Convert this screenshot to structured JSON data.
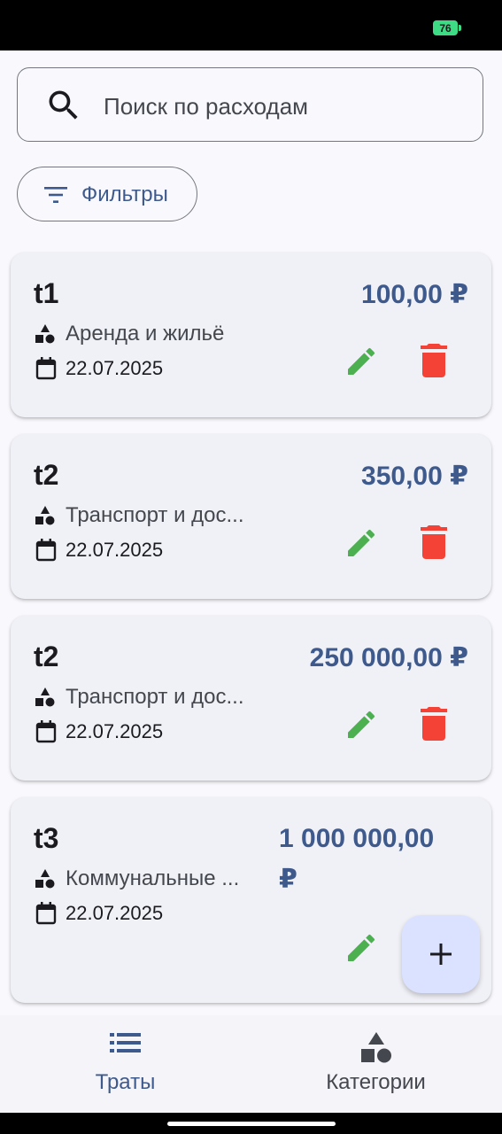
{
  "status": {
    "battery": "76"
  },
  "search": {
    "placeholder": "Поиск по расходам"
  },
  "filters": {
    "label": "Фильтры"
  },
  "expenses": [
    {
      "title": "t1",
      "amount": "100,00 ₽",
      "category": "Аренда и жильё",
      "date": "22.07.2025"
    },
    {
      "title": "t2",
      "amount": "350,00 ₽",
      "category": "Транспорт и дос...",
      "date": "22.07.2025"
    },
    {
      "title": "t2",
      "amount": "250 000,00 ₽",
      "category": "Транспорт и дос...",
      "date": "22.07.2025"
    },
    {
      "title": "t3",
      "amount": "1 000 000,00 ₽",
      "category": "Коммунальные ...",
      "date": "22.07.2025"
    }
  ],
  "nav": {
    "items": [
      {
        "label": "Траты",
        "icon": "list-icon"
      },
      {
        "label": "Категории",
        "icon": "category-shapes-icon"
      }
    ]
  },
  "colors": {
    "accent": "#3e5a8c",
    "edit": "#4caf50",
    "delete": "#f44336",
    "fab": "#dae2ff"
  }
}
